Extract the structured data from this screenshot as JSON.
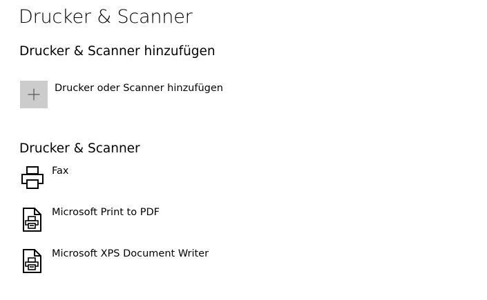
{
  "page": {
    "title": "Drucker & Scanner"
  },
  "add_section": {
    "heading": "Drucker & Scanner hinzufügen",
    "add_button_label": "Drucker oder Scanner hinzufügen",
    "add_icon": "plus-icon"
  },
  "devices_section": {
    "heading": "Drucker & Scanner",
    "devices": [
      {
        "label": "Fax",
        "icon": "printer-icon"
      },
      {
        "label": "Microsoft Print to PDF",
        "icon": "document-printer-icon"
      },
      {
        "label": "Microsoft XPS Document Writer",
        "icon": "document-printer-icon"
      }
    ]
  },
  "colors": {
    "tile_background": "#cccccc",
    "text": "#000000",
    "background": "#ffffff"
  }
}
